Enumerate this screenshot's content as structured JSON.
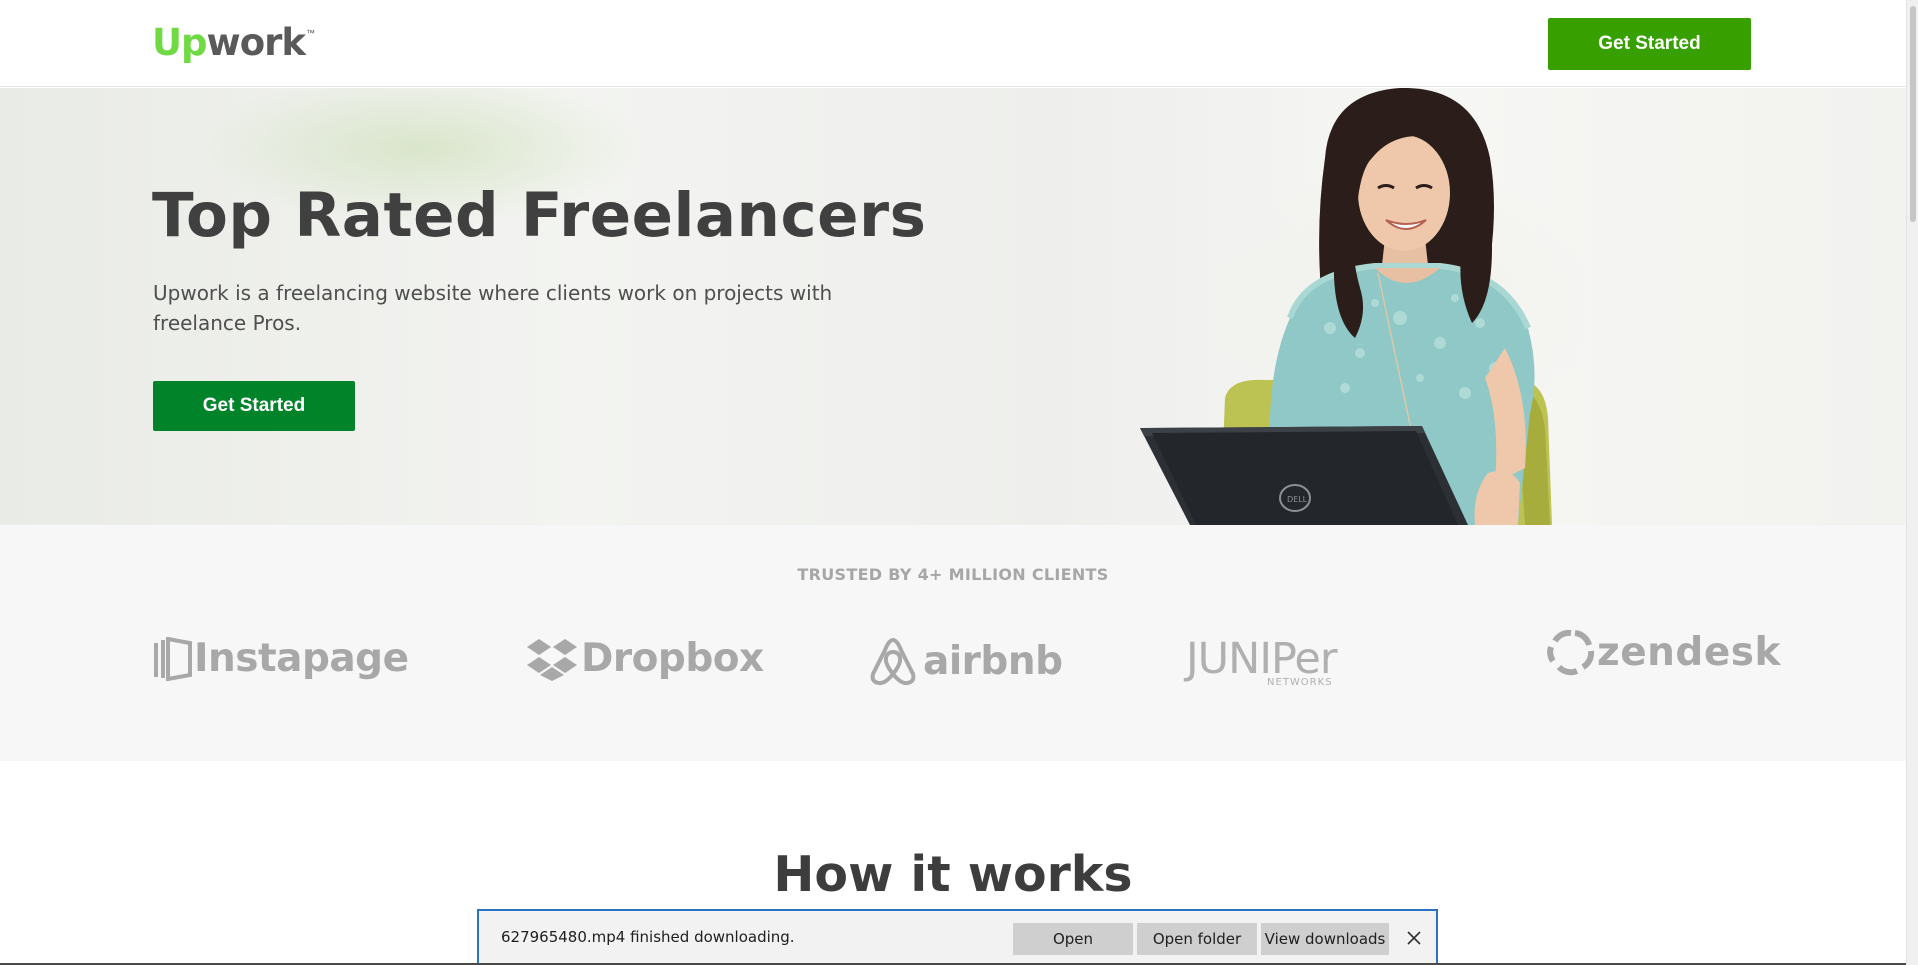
{
  "header": {
    "logo": {
      "up": "Up",
      "work": "work",
      "tm": "™"
    },
    "cta_label": "Get Started"
  },
  "hero": {
    "title": "Top Rated Freelancers",
    "subtitle": "Upwork is a freelancing website where clients work on projects with freelance Pros.",
    "cta_label": "Get Started",
    "laptop_brand": "DELL"
  },
  "trusted": {
    "title": "TRUSTED BY 4+ MILLION CLIENTS",
    "brands": [
      {
        "name": "Instapage",
        "icon": "instapage-icon"
      },
      {
        "name": "Dropbox",
        "icon": "dropbox-icon"
      },
      {
        "name": "airbnb",
        "icon": "airbnb-icon"
      },
      {
        "name": "JUNIPer",
        "sub": "NETWORKS"
      },
      {
        "name": "zendesk",
        "icon": "zendesk-icon"
      }
    ]
  },
  "how_it_works": {
    "title": "How it works"
  },
  "download_bar": {
    "message": "627965480.mp4 finished downloading.",
    "open_label": "Open",
    "open_folder_label": "Open folder",
    "view_downloads_label": "View downloads",
    "close_icon": "close-icon"
  },
  "colors": {
    "brand_green": "#6fda44",
    "header_cta": "#37a000",
    "hero_cta": "#008329",
    "logo_gray": "#a8a8a8",
    "download_bar_border": "#2a73c4"
  }
}
